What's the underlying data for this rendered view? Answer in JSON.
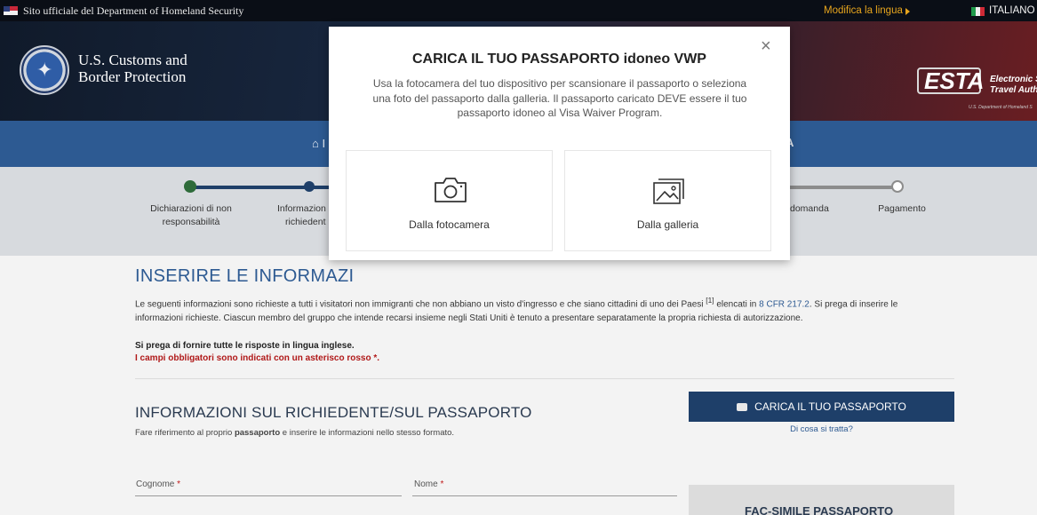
{
  "gov_strip": {
    "official_text": "Sito ufficiale del Department of Homeland Security",
    "change_language": "Modifica la lingua",
    "current_language": "ITALIANO"
  },
  "header": {
    "agency_line1": "U.S. Customs and",
    "agency_line2": "Border Protection",
    "esta_logo": "ESTA",
    "esta_title_line1": "Electronic Sy",
    "esta_title_line2": "Travel Authori",
    "esta_sub": "U.S. Department of Homeland S"
  },
  "nav": {
    "home_fragment": "I",
    "right_fragment": "A"
  },
  "progress": {
    "steps": [
      {
        "label_l1": "Dichiarazioni di non",
        "label_l2": "responsabilità",
        "state": "done"
      },
      {
        "label_l1": "Informazion",
        "label_l2": "richiedent",
        "state": "current"
      },
      {
        "label_l1": "domanda",
        "label_l2": "",
        "state": "todo"
      },
      {
        "label_l1": "Pagamento",
        "label_l2": "",
        "state": "todo"
      }
    ],
    "colors": {
      "done": "#1e3f69",
      "done_dot": "#2e6b3a",
      "todo": "#8c8c8c"
    }
  },
  "content": {
    "title": "INSERIRE LE INFORMAZI",
    "intro_part1": "Le seguenti informazioni sono richieste a tutti i visitatori non immigranti che non abbiano un visto d'ingresso e che siano cittadini di uno dei Paesi ",
    "intro_sup": "[1]",
    "intro_part2": " elencati in ",
    "intro_link": "8 CFR 217.2",
    "intro_part3": ". Si prega di inserire le informazioni richieste. Ciascun membro del gruppo che intende recarsi insieme negli Stati Uniti è tenuto a presentare separatamente la propria richiesta di autorizzazione.",
    "english_note": "Si prega di fornire tutte le risposte in lingua inglese.",
    "required_note": "I campi obbligatori sono indicati con un asterisco rosso *.",
    "section_title": "INFORMAZIONI SUL RICHIEDENTE/SUL PASSAPORTO",
    "section_sub_part1": "Fare riferimento al proprio ",
    "section_sub_bold": "passaporto",
    "section_sub_part2": " e inserire le informazioni nello stesso formato.",
    "upload_button": "CARICA IL TUO PASSAPORTO",
    "what_is_it": "Di cosa si tratta?",
    "surname_label": "Cognome",
    "name_label": "Nome",
    "asterisk": "*",
    "facsimile_title": "FAC-SIMILE PASSAPORTO"
  },
  "modal": {
    "title": "CARICA IL TUO PASSAPORTO idoneo VWP",
    "text": "Usa la fotocamera del tuo dispositivo per scansionare il passaporto o seleziona una foto del passaporto dalla galleria.  Il passaporto caricato DEVE essere il tuo passaporto idoneo al Visa Waiver Program.",
    "close": "×",
    "option_camera": "Dalla fotocamera",
    "option_gallery": "Dalla galleria",
    "camera_icon": "camera-icon",
    "gallery_icon": "gallery-icon"
  }
}
